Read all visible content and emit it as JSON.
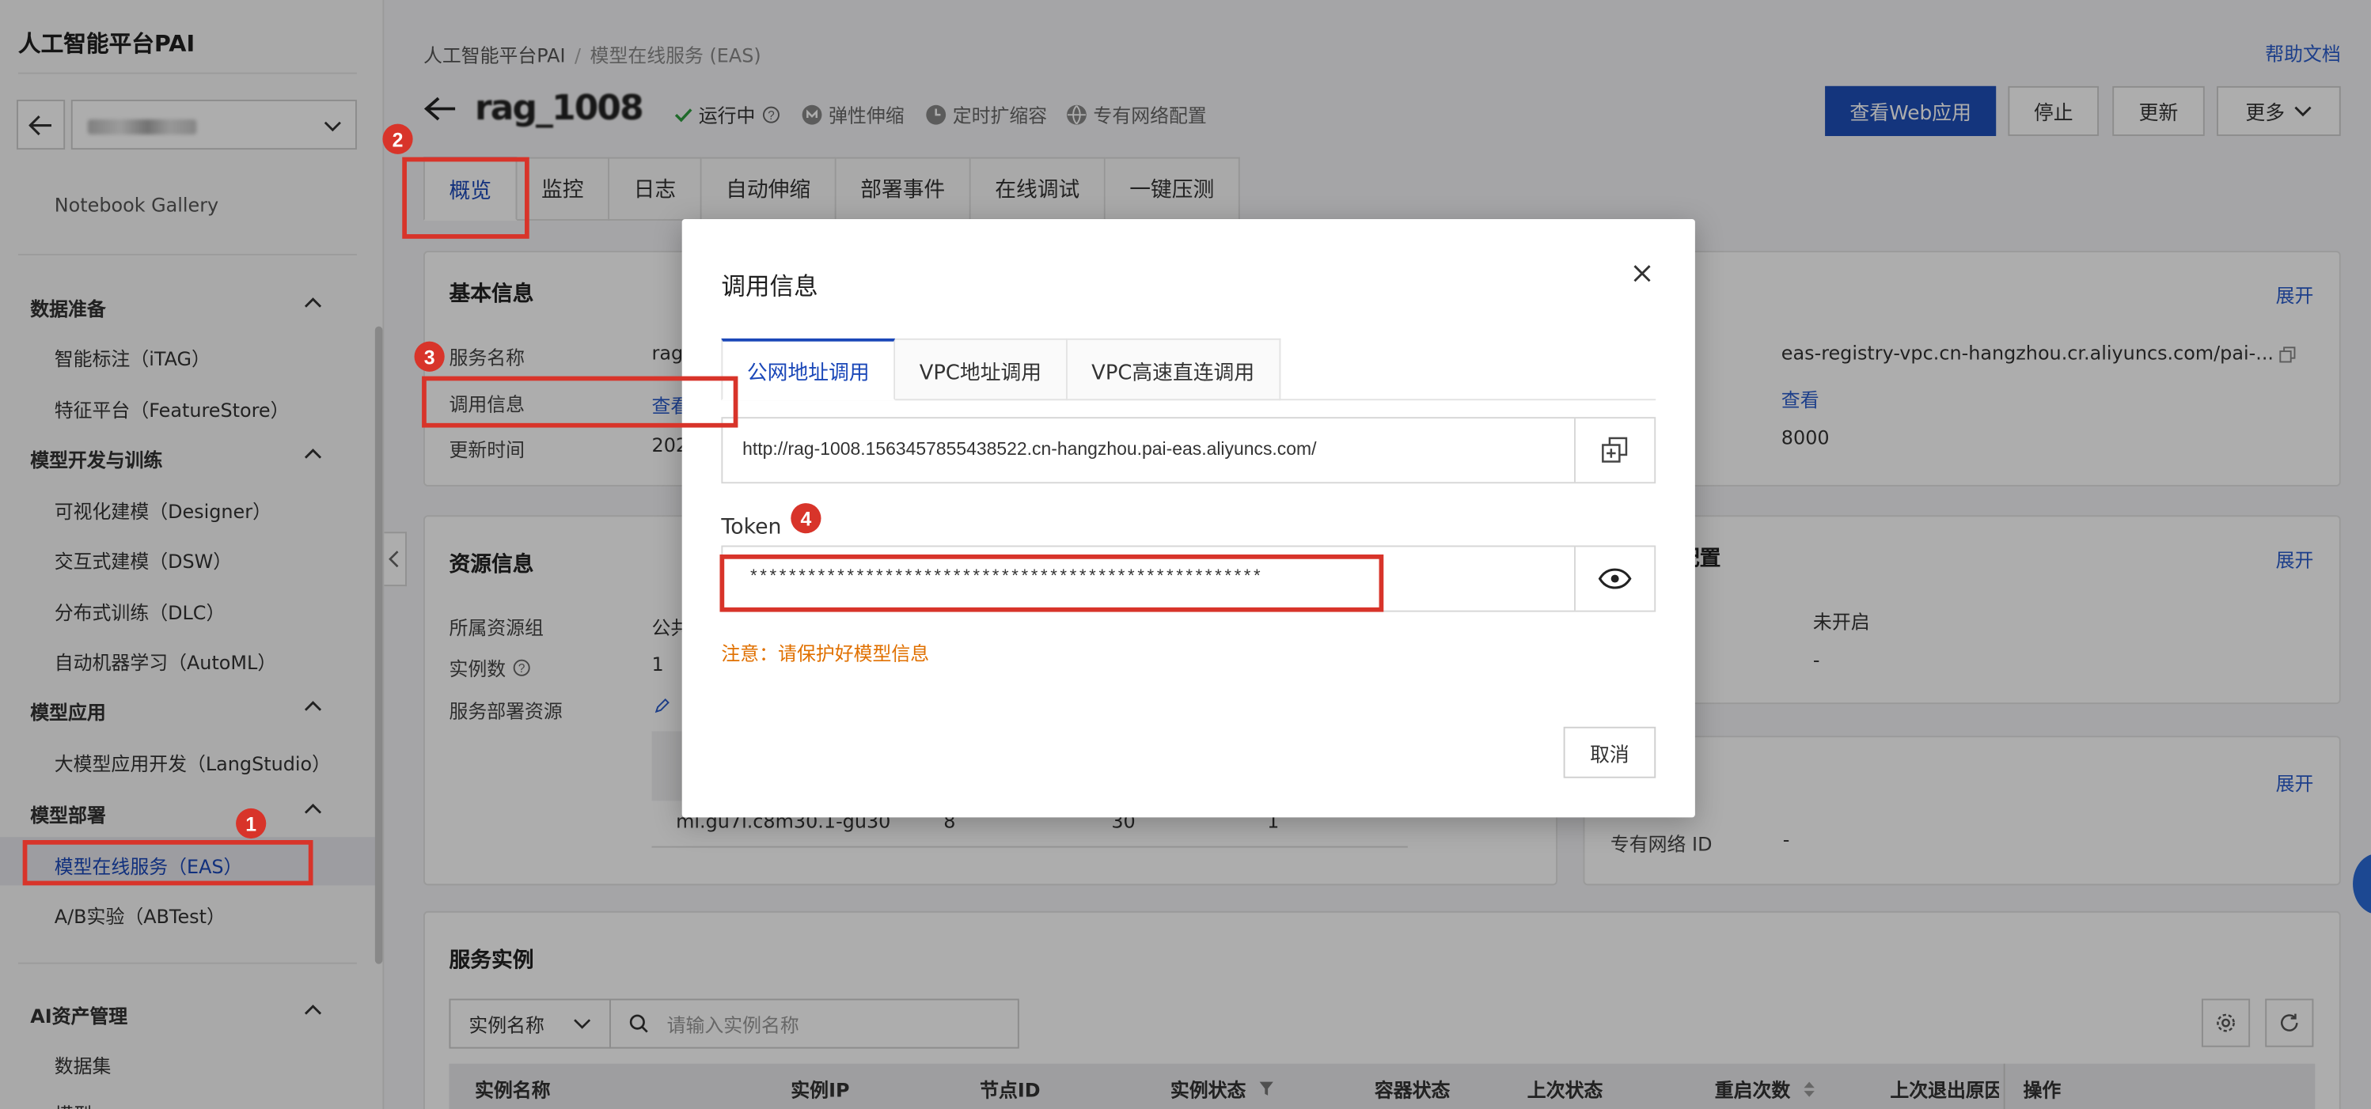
{
  "sidebar": {
    "brand": "人工智能平台PAI",
    "workspace": "",
    "partial_item": "Notebook Gallery",
    "sections": [
      {
        "title": "数据准备",
        "items": [
          "智能标注（iTAG）",
          "特征平台（FeatureStore）"
        ]
      },
      {
        "title": "模型开发与训练",
        "items": [
          "可视化建模（Designer）",
          "交互式建模（DSW）",
          "分布式训练（DLC）",
          "自动机器学习（AutoML）"
        ]
      },
      {
        "title": "模型应用",
        "items": [
          "大模型应用开发（LangStudio）"
        ]
      },
      {
        "title": "模型部署",
        "items": [
          "模型在线服务（EAS）",
          "A/B实验（ABTest）"
        ]
      },
      {
        "title": "AI资产管理",
        "items": [
          "数据集",
          "模型"
        ]
      }
    ]
  },
  "header": {
    "breadcrumb": [
      "人工智能平台PAI",
      "模型在线服务 (EAS)"
    ],
    "help": "帮助文档",
    "service_title": "rag_1008",
    "status": "运行中",
    "features": [
      "弹性伸缩",
      "定时扩缩容",
      "专有网络配置"
    ],
    "buttons": {
      "web": "查看Web应用",
      "stop": "停止",
      "update": "更新",
      "more": "更多"
    },
    "tabs": [
      "概览",
      "监控",
      "日志",
      "自动伸缩",
      "部署事件",
      "在线调试",
      "一键压测"
    ]
  },
  "basic": {
    "title": "基本信息",
    "rows": [
      {
        "label": "服务名称",
        "value": "rag"
      },
      {
        "label": "调用信息",
        "value": "查看"
      },
      {
        "label": "更新时间",
        "value": "202"
      }
    ]
  },
  "right1": {
    "expand": "展开",
    "image": "eas-registry-vpc.cn-hangzhou.cr.aliyuncs.com/pai-...",
    "view": "查看",
    "port": "8000"
  },
  "resource": {
    "title": "资源信息",
    "rows": [
      {
        "label": "所属资源组",
        "value": "公共"
      },
      {
        "label": "实例数",
        "value": "1"
      },
      {
        "label": "服务部署资源",
        "value": ""
      }
    ],
    "table_row": [
      "ml.gu7i.c8m30.1-gu30",
      "8",
      "30",
      "1"
    ]
  },
  "right2": {
    "title": "配置",
    "expand": "展开",
    "v1": "未开启",
    "v2": "-"
  },
  "right3": {
    "expand": "展开",
    "label": "专有网络 ID",
    "value": "-"
  },
  "instances": {
    "title": "服务实例",
    "select": "实例名称",
    "search_placeholder": "请输入实例名称",
    "columns": [
      "实例名称",
      "实例IP",
      "节点ID",
      "实例状态",
      "容器状态",
      "上次状态",
      "重启次数",
      "上次退出原因",
      "操作"
    ]
  },
  "modal": {
    "title": "调用信息",
    "tabs": [
      "公网地址调用",
      "VPC地址调用",
      "VPC高速直连调用"
    ],
    "url": "http://rag-1008.1563457855438522.cn-hangzhou.pai-eas.aliyuncs.com/",
    "token_label": "Token",
    "token": "*****************************************************",
    "warning": "注意：请保护好模型信息",
    "cancel": "取消"
  },
  "annotations": [
    "1",
    "2",
    "3",
    "4"
  ],
  "colors": {
    "accent": "#1e4fb8",
    "marker": "#d8342a",
    "warning": "#e07000",
    "running": "#2e9c3f"
  }
}
